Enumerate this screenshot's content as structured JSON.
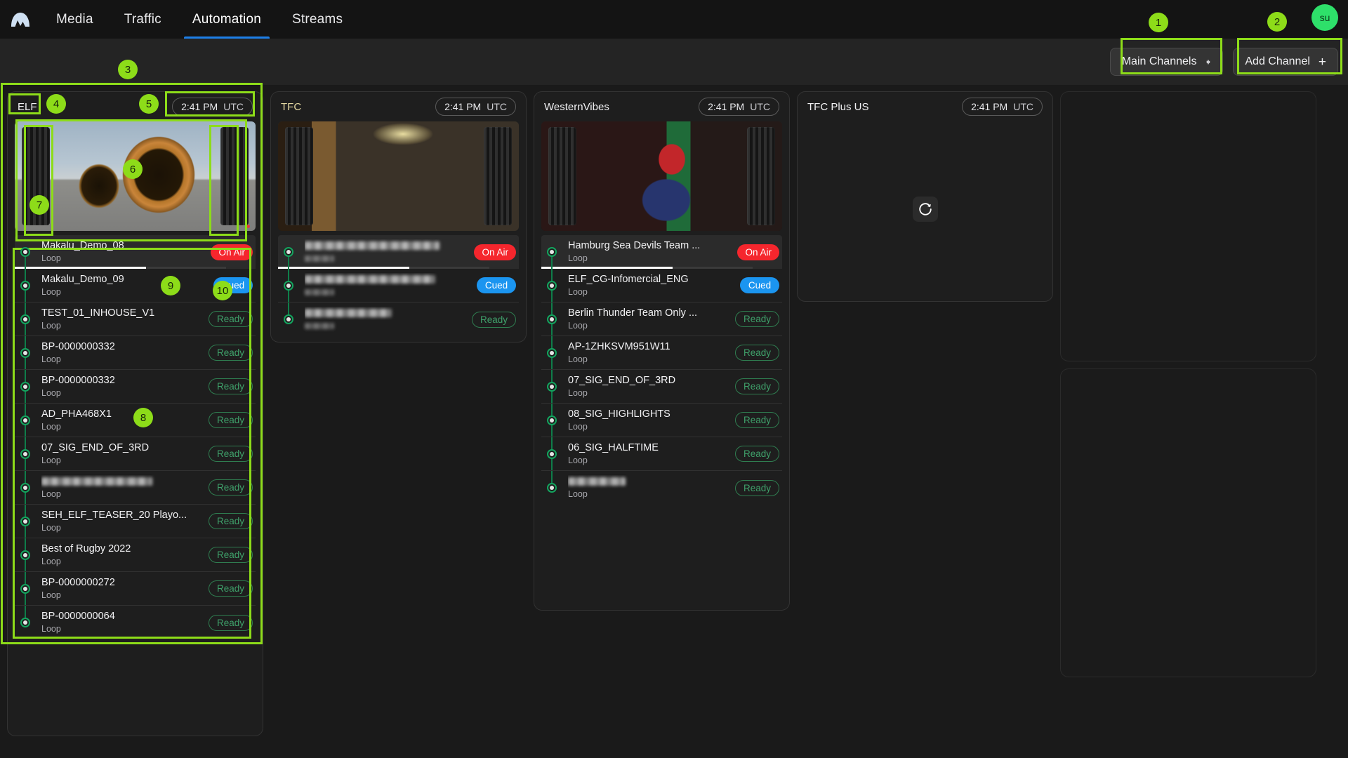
{
  "app": {
    "logo_name": "mountain-logo",
    "nav": [
      {
        "label": "Media",
        "active": false
      },
      {
        "label": "Traffic",
        "active": false
      },
      {
        "label": "Automation",
        "active": true
      },
      {
        "label": "Streams",
        "active": false
      }
    ],
    "avatar_initials": "su",
    "avatar_color": "#2ee06a",
    "accent_color": "#1d7fe8",
    "highlight_color": "#8ddc19"
  },
  "toolbar": {
    "channel_filter_label": "Main Channels",
    "add_channel_label": "Add Channel",
    "add_channel_icon": "plus-icon",
    "stepper_icon": "chevron-up-down-icon"
  },
  "annotations": [
    {
      "n": "1",
      "target": "main-channels-select"
    },
    {
      "n": "2",
      "target": "add-channel-button"
    },
    {
      "n": "3",
      "target": "channel-card-elf"
    },
    {
      "n": "4",
      "target": "channel-title-elf"
    },
    {
      "n": "5",
      "target": "channel-clock-elf"
    },
    {
      "n": "6",
      "target": "channel-preview-elf"
    },
    {
      "n": "7",
      "target": "audio-meter-left"
    },
    {
      "n": "8",
      "target": "playlist-elf"
    },
    {
      "n": "9",
      "target": "playlist-row-onair"
    },
    {
      "n": "10",
      "target": "status-badge-cued"
    }
  ],
  "channels": [
    {
      "id": "elf",
      "title": "ELF",
      "title_style": "plain",
      "time": "2:41 PM",
      "timezone": "UTC",
      "state": "playing",
      "thumb_class": "elf",
      "playlist": [
        {
          "name": "Makalu_Demo_08",
          "sub": "Loop",
          "status": "On Air",
          "status_kind": "onair",
          "redacted": false
        },
        {
          "name": "Makalu_Demo_09",
          "sub": "Loop",
          "status": "Cued",
          "status_kind": "cued",
          "redacted": false
        },
        {
          "name": "TEST_01_INHOUSE_V1",
          "sub": "Loop",
          "status": "Ready",
          "status_kind": "ready",
          "redacted": false
        },
        {
          "name": "BP-0000000332",
          "sub": "Loop",
          "status": "Ready",
          "status_kind": "ready",
          "redacted": false
        },
        {
          "name": "BP-0000000332",
          "sub": "Loop",
          "status": "Ready",
          "status_kind": "ready",
          "redacted": false
        },
        {
          "name": "AD_PHA468X1",
          "sub": "Loop",
          "status": "Ready",
          "status_kind": "ready",
          "redacted": false
        },
        {
          "name": "07_SIG_END_OF_3RD",
          "sub": "Loop",
          "status": "Ready",
          "status_kind": "ready",
          "redacted": false
        },
        {
          "name": "",
          "sub": "Loop",
          "status": "Ready",
          "status_kind": "ready",
          "redacted": true,
          "redact_width": 158
        },
        {
          "name": "SEH_ELF_TEASER_20 Playo...",
          "sub": "Loop",
          "status": "Ready",
          "status_kind": "ready",
          "redacted": false
        },
        {
          "name": "Best of Rugby 2022",
          "sub": "Loop",
          "status": "Ready",
          "status_kind": "ready",
          "redacted": false
        },
        {
          "name": "BP-0000000272",
          "sub": "Loop",
          "status": "Ready",
          "status_kind": "ready",
          "redacted": false
        },
        {
          "name": "BP-0000000064",
          "sub": "Loop",
          "status": "Ready",
          "status_kind": "ready",
          "redacted": false
        }
      ]
    },
    {
      "id": "tfc",
      "title": "TFC",
      "title_style": "tfc",
      "time": "2:41 PM",
      "timezone": "UTC",
      "state": "playing",
      "thumb_class": "tfc",
      "playlist": [
        {
          "name": "",
          "sub": "",
          "status": "On Air",
          "status_kind": "onair",
          "redacted": true,
          "redact_width": 192
        },
        {
          "name": "",
          "sub": "",
          "status": "Cued",
          "status_kind": "cued",
          "redacted": true,
          "redact_width": 186
        },
        {
          "name": "",
          "sub": "",
          "status": "Ready",
          "status_kind": "ready",
          "redacted": true,
          "redact_width": 124
        }
      ]
    },
    {
      "id": "westernvibes",
      "title": "WesternVibes",
      "title_style": "plain",
      "time": "2:41 PM",
      "timezone": "UTC",
      "state": "playing",
      "thumb_class": "wv",
      "playlist": [
        {
          "name": "Hamburg Sea Devils Team ...",
          "sub": "Loop",
          "status": "On Air",
          "status_kind": "onair",
          "redacted": false
        },
        {
          "name": "ELF_CG-Infomercial_ENG",
          "sub": "Loop",
          "status": "Cued",
          "status_kind": "cued",
          "redacted": false
        },
        {
          "name": "Berlin Thunder Team Only ...",
          "sub": "Loop",
          "status": "Ready",
          "status_kind": "ready",
          "redacted": false
        },
        {
          "name": "AP-1ZHKSVM951W11",
          "sub": "Loop",
          "status": "Ready",
          "status_kind": "ready",
          "redacted": false
        },
        {
          "name": "07_SIG_END_OF_3RD",
          "sub": "Loop",
          "status": "Ready",
          "status_kind": "ready",
          "redacted": false
        },
        {
          "name": "08_SIG_HIGHLIGHTS",
          "sub": "Loop",
          "status": "Ready",
          "status_kind": "ready",
          "redacted": false
        },
        {
          "name": "06_SIG_HALFTIME",
          "sub": "Loop",
          "status": "Ready",
          "status_kind": "ready",
          "redacted": false
        },
        {
          "name": "",
          "sub": "Loop",
          "status": "Ready",
          "status_kind": "ready",
          "redacted": true,
          "redact_width": 82
        }
      ]
    },
    {
      "id": "tfcplusus",
      "title": "TFC Plus US",
      "title_style": "plain",
      "time": "2:41 PM",
      "timezone": "UTC",
      "state": "loading",
      "loading_icon": "refresh-icon",
      "playlist": []
    }
  ],
  "status_colors": {
    "on_air": "#f5262d",
    "cued": "#1b95f0",
    "ready": "#3fa06a"
  }
}
